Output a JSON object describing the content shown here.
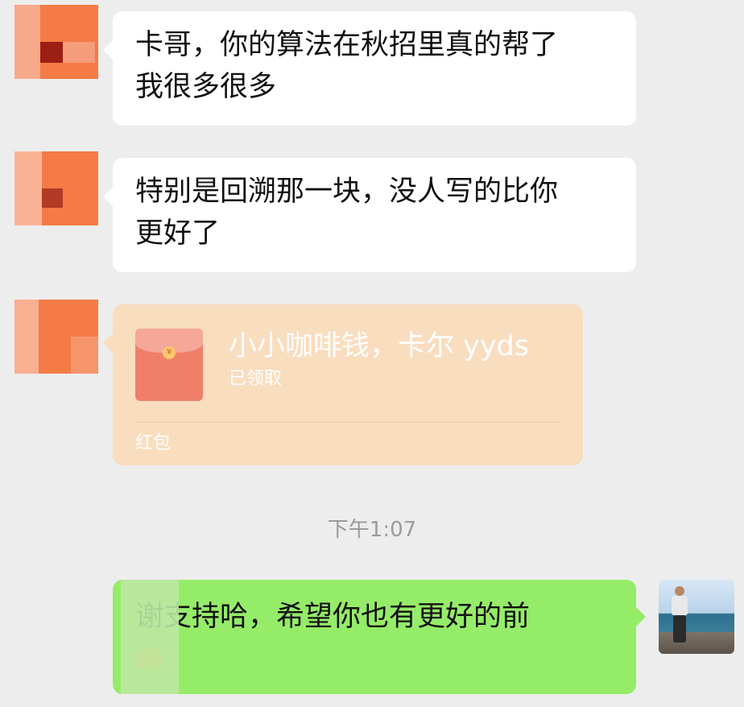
{
  "messages": [
    {
      "side": "left",
      "lines": [
        "卡哥，你的算法在秋招里真的帮了",
        "我很多很多"
      ]
    },
    {
      "side": "left",
      "lines": [
        "特别是回溯那一块，没人写的比你",
        "更好了"
      ]
    }
  ],
  "red_packet": {
    "title": "小小咖啡钱，卡尔 yyds",
    "status": "已领取",
    "footer": "红包",
    "coin_symbol": "¥",
    "background": "#f9ddbf"
  },
  "timestamp": "下午1:07",
  "reply": {
    "side": "right",
    "lines": [
      "谢支持哈，希望你也有更好的前"
    ],
    "emoji": "folded-hands-emoji"
  },
  "colors": {
    "chat_background": "#ededed",
    "incoming_bubble": "#ffffff",
    "outgoing_bubble": "#95ec69",
    "avatar_orange": "#f47b45"
  }
}
